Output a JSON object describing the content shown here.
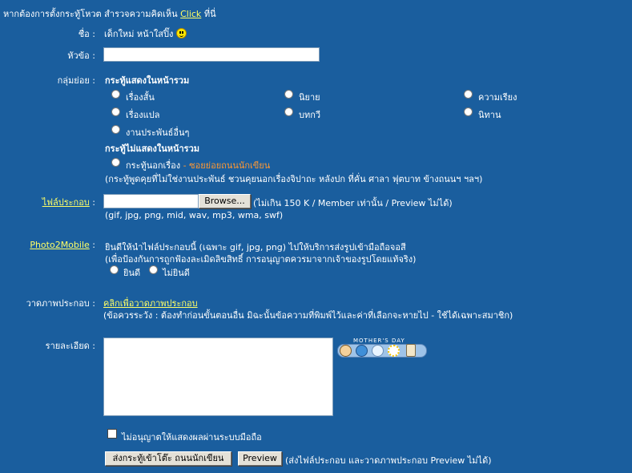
{
  "header": {
    "intro_text": "หากต้องการตั้งกระทู้โหวต สำรวจความคิดเห็น",
    "click_link": "Click",
    "suffix": "ที่นี่"
  },
  "name_row": {
    "label": "ชื่อ :",
    "value": "เด็กใหม่ หน้าใสปิ๊ง"
  },
  "subject_row": {
    "label": "หัวข้อ :",
    "value": ""
  },
  "group_row": {
    "label": "กลุ่มย่อย :",
    "shown_heading": "กระทู้แสดงในหน้ารวม",
    "options": [
      "เรื่องสั้น",
      "นิยาย",
      "ความเรียง",
      "เรื่องแปล",
      "บทกวี",
      "นิทาน",
      "งานประพันธ์อื่นๆ"
    ],
    "hidden_heading": "กระทู้ไม่แสดงในหน้ารวม",
    "hidden_option": "กระทู้นอกเรื่อง",
    "hidden_option_suffix": "- ซอยย่อยถนนนักเขียน",
    "hidden_note": "(กระทู้พูดคุยที่ไม่ใช่งานประพันธ์ ชวนคุยนอกเรื่องจิปาถะ หลังปก ที่คั่น ศาลา ฟุตบาท ข้างถนนฯ ฯลฯ)"
  },
  "file_row": {
    "label": "ไฟล์ประกอบ",
    "colon": ":",
    "browse_label": "Browse...",
    "limit_note": "(ไม่เกิน 150 K / Member เท่านั้น / Preview ไม่ได้)",
    "types_note": "(gif, jpg, png, mid, wav, mp3, wma, swf)"
  },
  "photo_row": {
    "label": "Photo2Mobile",
    "colon": ":",
    "line1": "ยินดีให้นำไฟล์ประกอบนี้ (เฉพาะ gif, jpg, png) ไปให้บริการส่งรูปเข้ามือถือจอสี",
    "line2": "(เพื่อป้องกันการถูกฟ้องละเมิดลิขสิทธิ์ การอนุญาตควรมาจากเจ้าของรูปโดยแท้จริง)",
    "yes_label": "ยินดี",
    "no_label": "ไม่ยินดี"
  },
  "draw_row": {
    "label": "วาดภาพประกอบ :",
    "link": "คลิกเพื่อวาดภาพประกอบ",
    "note": "(ข้อควรระวัง : ต้องทำก่อนขั้นตอนอื่น มิฉะนั้นข้อความที่พิมพ์ไว้และค่าที่เลือกจะหายไป - ใช้ได้เฉพาะสมาชิก)"
  },
  "detail_row": {
    "label": "รายละเอียด :",
    "value": "",
    "emoticon_title": "MOTHER'S DAY"
  },
  "mobile_checkbox": {
    "label": "ไม่อนุญาตให้แสดงผลผ่านระบบมือถือ",
    "checked": false
  },
  "actions": {
    "submit_label": "ส่งกระทู้เข้าโต๊ะ ถนนนักเขียน",
    "preview_label": "Preview",
    "preview_note": "(ส่งไฟล์ประกอบ และวาดภาพประกอบ Preview ไม่ได้)"
  },
  "colors": {
    "background": "#1a5e9e",
    "link": "#ffff66",
    "accent": "#ff9933"
  }
}
